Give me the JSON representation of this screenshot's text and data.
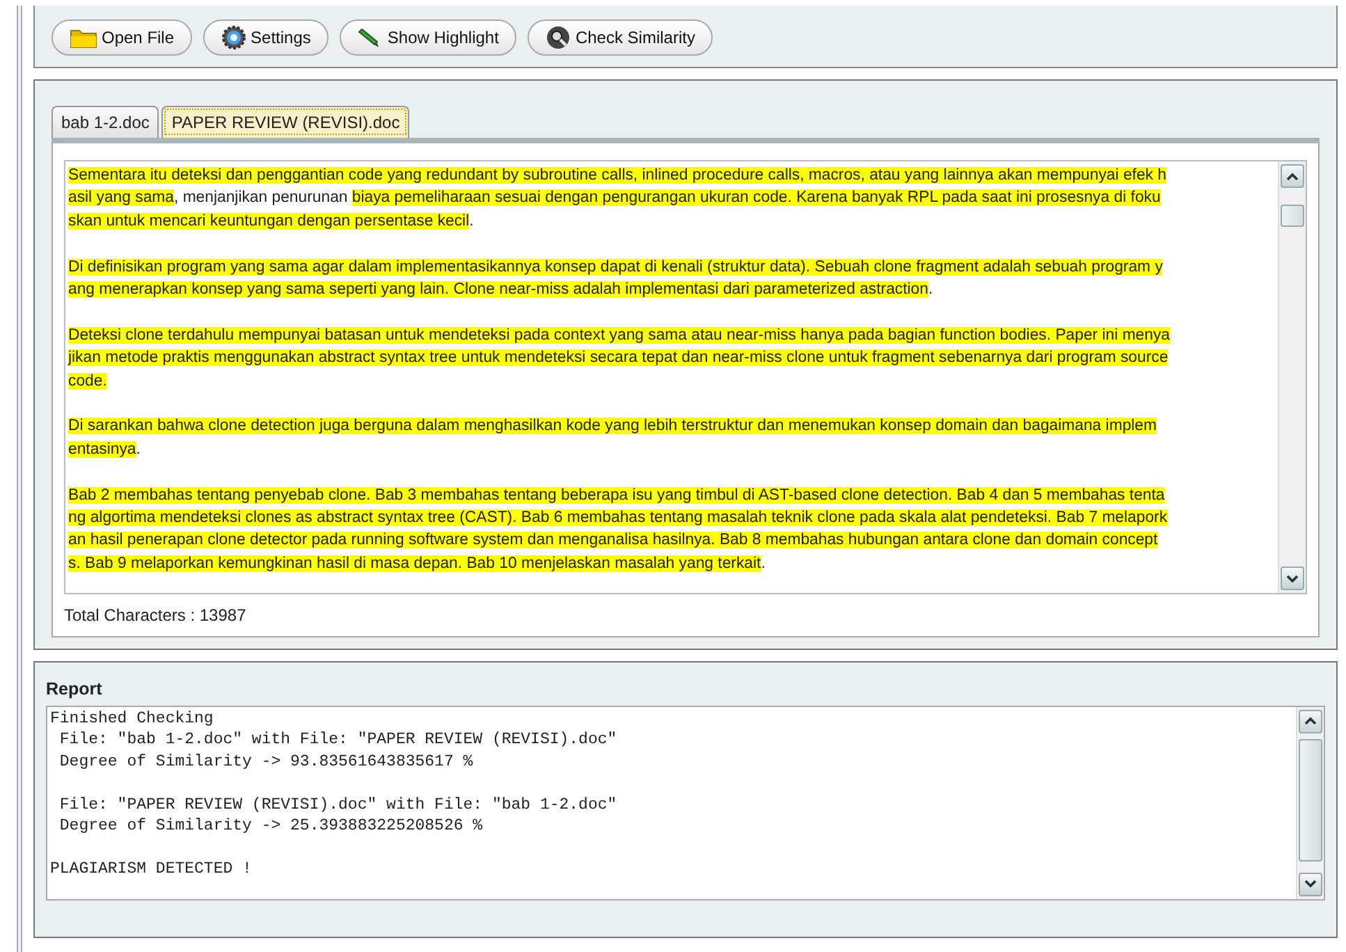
{
  "toolbar": [
    {
      "label": "Open File",
      "kind": "folder"
    },
    {
      "label": "Settings",
      "kind": "gear"
    },
    {
      "label": "Show Highlight",
      "kind": "pen"
    },
    {
      "label": "Check Similarity",
      "kind": "magnifier"
    }
  ],
  "tabs": [
    {
      "label": "bab 1-2.doc",
      "selected": false
    },
    {
      "label": "PAPER REVIEW (REVISI).doc",
      "selected": true
    }
  ],
  "document": {
    "paragraphs": [
      {
        "lines": [
          [
            {
              "text": "Sementara itu deteksi dan penggantian code yang redundant by subroutine calls, inlined procedure calls, macros, atau yang lainnya akan mempunyai efek h",
              "highlighted": true
            }
          ],
          [
            {
              "text": "asil yang sama",
              "highlighted": true
            },
            {
              "text": ", menjanjikan penurunan ",
              "highlighted": false
            },
            {
              "text": "biaya pemeliharaan sesuai dengan pengurangan ukuran code. Karena banyak RPL pada saat ini prosesnya di foku",
              "highlighted": true
            }
          ],
          [
            {
              "text": "skan untuk mencari keuntungan dengan persentase kecil",
              "highlighted": true
            },
            {
              "text": ".",
              "highlighted": false
            }
          ]
        ]
      },
      {
        "lines": [
          [
            {
              "text": "Di definisikan program yang sama agar dalam implementasikannya konsep dapat di kenali (struktur data). Sebuah clone fragment adalah sebuah program y",
              "highlighted": true
            }
          ],
          [
            {
              "text": "ang menerapkan konsep yang sama seperti yang lain. Clone near-miss adalah implementasi dari parameterized astraction",
              "highlighted": true
            },
            {
              "text": ".",
              "highlighted": false
            }
          ]
        ]
      },
      {
        "lines": [
          [
            {
              "text": "Deteksi clone terdahulu mempunyai batasan untuk mendeteksi pada context yang sama atau near-miss hanya pada bagian function bodies. Paper ini menya",
              "highlighted": true
            }
          ],
          [
            {
              "text": "jikan metode praktis menggunakan abstract syntax tree untuk mendeteksi secara tepat dan near-miss clone untuk fragment sebenarnya dari program source",
              "highlighted": true
            }
          ],
          [
            {
              "text": " code.",
              "highlighted": true
            }
          ]
        ]
      },
      {
        "lines": [
          [
            {
              "text": "Di sarankan bahwa clone detection juga berguna dalam menghasilkan kode yang lebih terstruktur dan menemukan konsep domain dan bagaimana implem",
              "highlighted": true
            }
          ],
          [
            {
              "text": "entasinya",
              "highlighted": true
            },
            {
              "text": ".",
              "highlighted": false
            }
          ]
        ]
      },
      {
        "lines": [
          [
            {
              "text": "Bab 2 membahas tentang penyebab clone. Bab 3 membahas tentang beberapa isu yang timbul di AST-based clone detection. Bab 4 dan 5 membahas tenta",
              "highlighted": true
            }
          ],
          [
            {
              "text": "ng algortima mendeteksi clones as abstract syntax tree (CAST). Bab 6 membahas tentang masalah teknik clone pada skala alat pendeteksi. Bab 7 melapork",
              "highlighted": true
            }
          ],
          [
            {
              "text": "an hasil penerapan clone detector pada running software system dan menganalisa hasilnya. Bab 8 membahas hubungan antara clone dan domain concept",
              "highlighted": true
            }
          ],
          [
            {
              "text": "s. Bab 9 melaporkan kemungkinan hasil di masa depan. Bab 10 menjelaskan masalah yang terkait",
              "highlighted": true
            },
            {
              "text": ".",
              "highlighted": false
            }
          ]
        ]
      }
    ]
  },
  "total_characters": "Total Characters : 13987",
  "report": {
    "title": "Report",
    "blocks": [
      [
        "Finished Checking",
        " File: \"bab 1-2.doc\" with File: \"PAPER REVIEW (REVISI).doc\"",
        " Degree of Similarity -> 93.83561643835617 %"
      ],
      [
        " File: \"PAPER REVIEW (REVISI).doc\" with File: \"bab 1-2.doc\"",
        " Degree of Similarity -> 25.393883225208526 %"
      ],
      [
        "PLAGIARISM DETECTED !"
      ]
    ]
  }
}
